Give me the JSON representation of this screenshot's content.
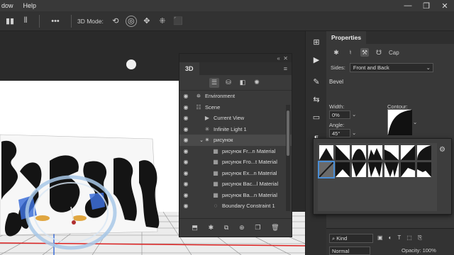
{
  "menubar": {
    "items": [
      "dow",
      "Help"
    ]
  },
  "window_controls": {
    "minimize": "—",
    "maximize": "❐",
    "close": "✕"
  },
  "optionsbar": {
    "mode_label": "3D Mode:",
    "more": "•••"
  },
  "panel3d": {
    "tab": "3D",
    "tree": [
      {
        "label": "Environment",
        "icon": "environment-icon",
        "indent": 0,
        "selected": false
      },
      {
        "label": "Scene",
        "icon": "scene-icon",
        "indent": 0,
        "selected": false
      },
      {
        "label": "Current View",
        "icon": "camera-icon",
        "indent": 1,
        "selected": false
      },
      {
        "label": "Infinite Light 1",
        "icon": "light-icon",
        "indent": 1,
        "selected": false
      },
      {
        "label": "рисунок",
        "icon": "mesh-icon",
        "indent": 1,
        "selected": true
      },
      {
        "label": "рисунок Fr...n Material",
        "icon": "material-icon",
        "indent": 2,
        "selected": false
      },
      {
        "label": "рисунок Fro...t Material",
        "icon": "material-icon",
        "indent": 2,
        "selected": false
      },
      {
        "label": "рисунок Ex...n Material",
        "icon": "material-icon",
        "indent": 2,
        "selected": false
      },
      {
        "label": "рисунок Bac...l Material",
        "icon": "material-icon",
        "indent": 2,
        "selected": false
      },
      {
        "label": "рисунок Ba...n Material",
        "icon": "material-icon",
        "indent": 2,
        "selected": false
      },
      {
        "label": "Boundary Constraint 1",
        "icon": "constraint-icon",
        "indent": 2,
        "selected": false
      }
    ]
  },
  "properties": {
    "tab": "Properties",
    "cap_label": "Cap",
    "sides_label": "Sides:",
    "sides_value": "Front and Back",
    "bevel_label": "Bevel",
    "width_label": "Width:",
    "width_value": "0%",
    "contour_label": "Contour:",
    "angle_label": "Angle:",
    "angle_value": "45°"
  },
  "layers": {
    "kind_value": "Kind",
    "blend_value": "Normal",
    "opacity_label": "Opacity: 100%"
  },
  "colors": {
    "accent": "#4a8ed6",
    "gizmo_blue": "#3d6fd9",
    "panel_bg": "#3a3a3a"
  }
}
